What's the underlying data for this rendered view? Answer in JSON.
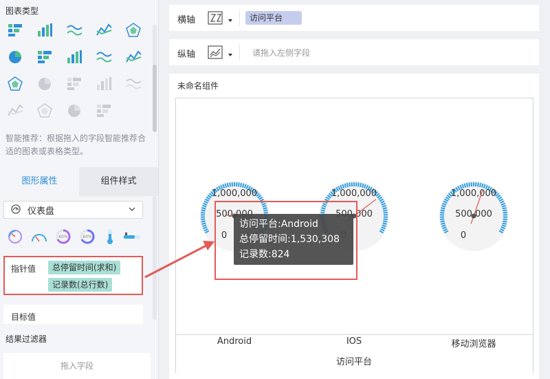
{
  "left_panel": {
    "chart_type_title": "图表类型",
    "chart_type_icons": [
      "table-icon",
      "bar-icon",
      "line-icon",
      "area-line-icon",
      "radar-icon",
      "combo-line-icon",
      "stacked-bar-icon",
      "scatter-icon",
      "bubble-icon",
      "pie-icon",
      "donut-icon",
      "china-map-icon",
      "map-dots-icon",
      "map-dots2-icon",
      "map-dots3-icon",
      "treemap-icon",
      "wordcloud-icon",
      "funnel-icon",
      "gauge-percent-icon"
    ],
    "hint": "智能推荐：根据拖入的字段智能推荐合适的图表或表格类型。",
    "tabs": [
      "图形属性",
      "组件样式"
    ],
    "select_label": "仪表盘",
    "gauge_style_icons": [
      "gauge-style-1-icon",
      "gauge-style-2-icon",
      "ring-60-icon",
      "ring-60b-icon",
      "thermometer-icon",
      "slider-icon"
    ],
    "pointer_label": "指针值",
    "pointer_tags": [
      "总停留时间(求和)",
      "记录数(总行数)"
    ],
    "target_label": "目标值",
    "filter_title": "结果过滤器",
    "drop_hint": "拖入字段"
  },
  "x_axis": {
    "label": "横轴",
    "field": "访问平台"
  },
  "y_axis": {
    "label": "纵轴",
    "placeholder": "请拖入左侧字段"
  },
  "widget": {
    "title": "未命名组件",
    "x_title": "访问平台",
    "tick_labels": [
      "1,000,000",
      "500,000",
      "0"
    ]
  },
  "tooltip": {
    "line1": "访问平台:Android",
    "line2": "总停留时间:1,530,308",
    "line3": "记录数:824"
  },
  "colors": {
    "accent": "#2f8fd6",
    "gauge_arc": "#2f9fe0",
    "needle": "#e2534e",
    "highlight": "#e25a58",
    "tag": "#a9dfd5",
    "pill": "#c5cdef"
  },
  "chart_data": {
    "type": "gauge",
    "categories": [
      "Android",
      "IOS",
      "移动浏览器"
    ],
    "max": 1000000,
    "values": [
      1530308,
      null,
      null
    ],
    "xlabel": "访问平台"
  }
}
